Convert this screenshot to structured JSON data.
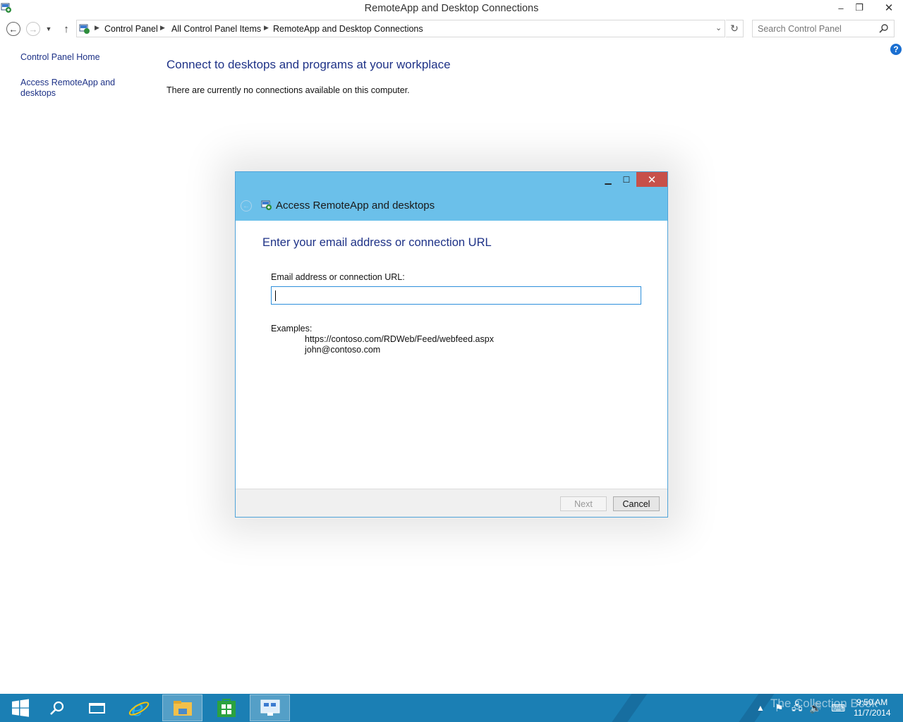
{
  "window": {
    "title": "RemoteApp and Desktop Connections",
    "minimize": "–",
    "restore": "❐",
    "close": "✕"
  },
  "nav": {
    "back_icon": "back-arrow-icon",
    "forward_icon": "forward-arrow-icon",
    "recent_icon": "chevron-down-icon",
    "up_icon": "up-arrow-icon",
    "breadcrumbs": [
      "Control Panel",
      "All Control Panel Items",
      "RemoteApp and Desktop Connections"
    ],
    "search_placeholder": "Search Control Panel"
  },
  "sidebar": {
    "items": [
      {
        "label": "Control Panel Home"
      },
      {
        "label": "Access RemoteApp and desktops"
      }
    ]
  },
  "main": {
    "heading": "Connect to desktops and programs at your workplace",
    "status": "There are currently no connections available on this computer."
  },
  "dialog": {
    "title": "Access RemoteApp and desktops",
    "heading": "Enter your email address or connection URL",
    "field_label": "Email address or connection URL:",
    "field_value": "",
    "examples_label": "Examples:",
    "examples": [
      "https://contoso.com/RDWeb/Feed/webfeed.aspx",
      "john@contoso.com"
    ],
    "next_label": "Next",
    "cancel_label": "Cancel",
    "header_color": "#6bc0ea"
  },
  "taskbar": {
    "apps": [
      "start-icon",
      "search-icon",
      "task-view-icon",
      "internet-explorer-icon",
      "file-explorer-icon",
      "store-icon",
      "remoteapp-icon"
    ],
    "clock_time": "9:50 AM",
    "clock_date": "11/7/2014",
    "watermark": "The Collection Book",
    "color": "#1b7fb4"
  }
}
